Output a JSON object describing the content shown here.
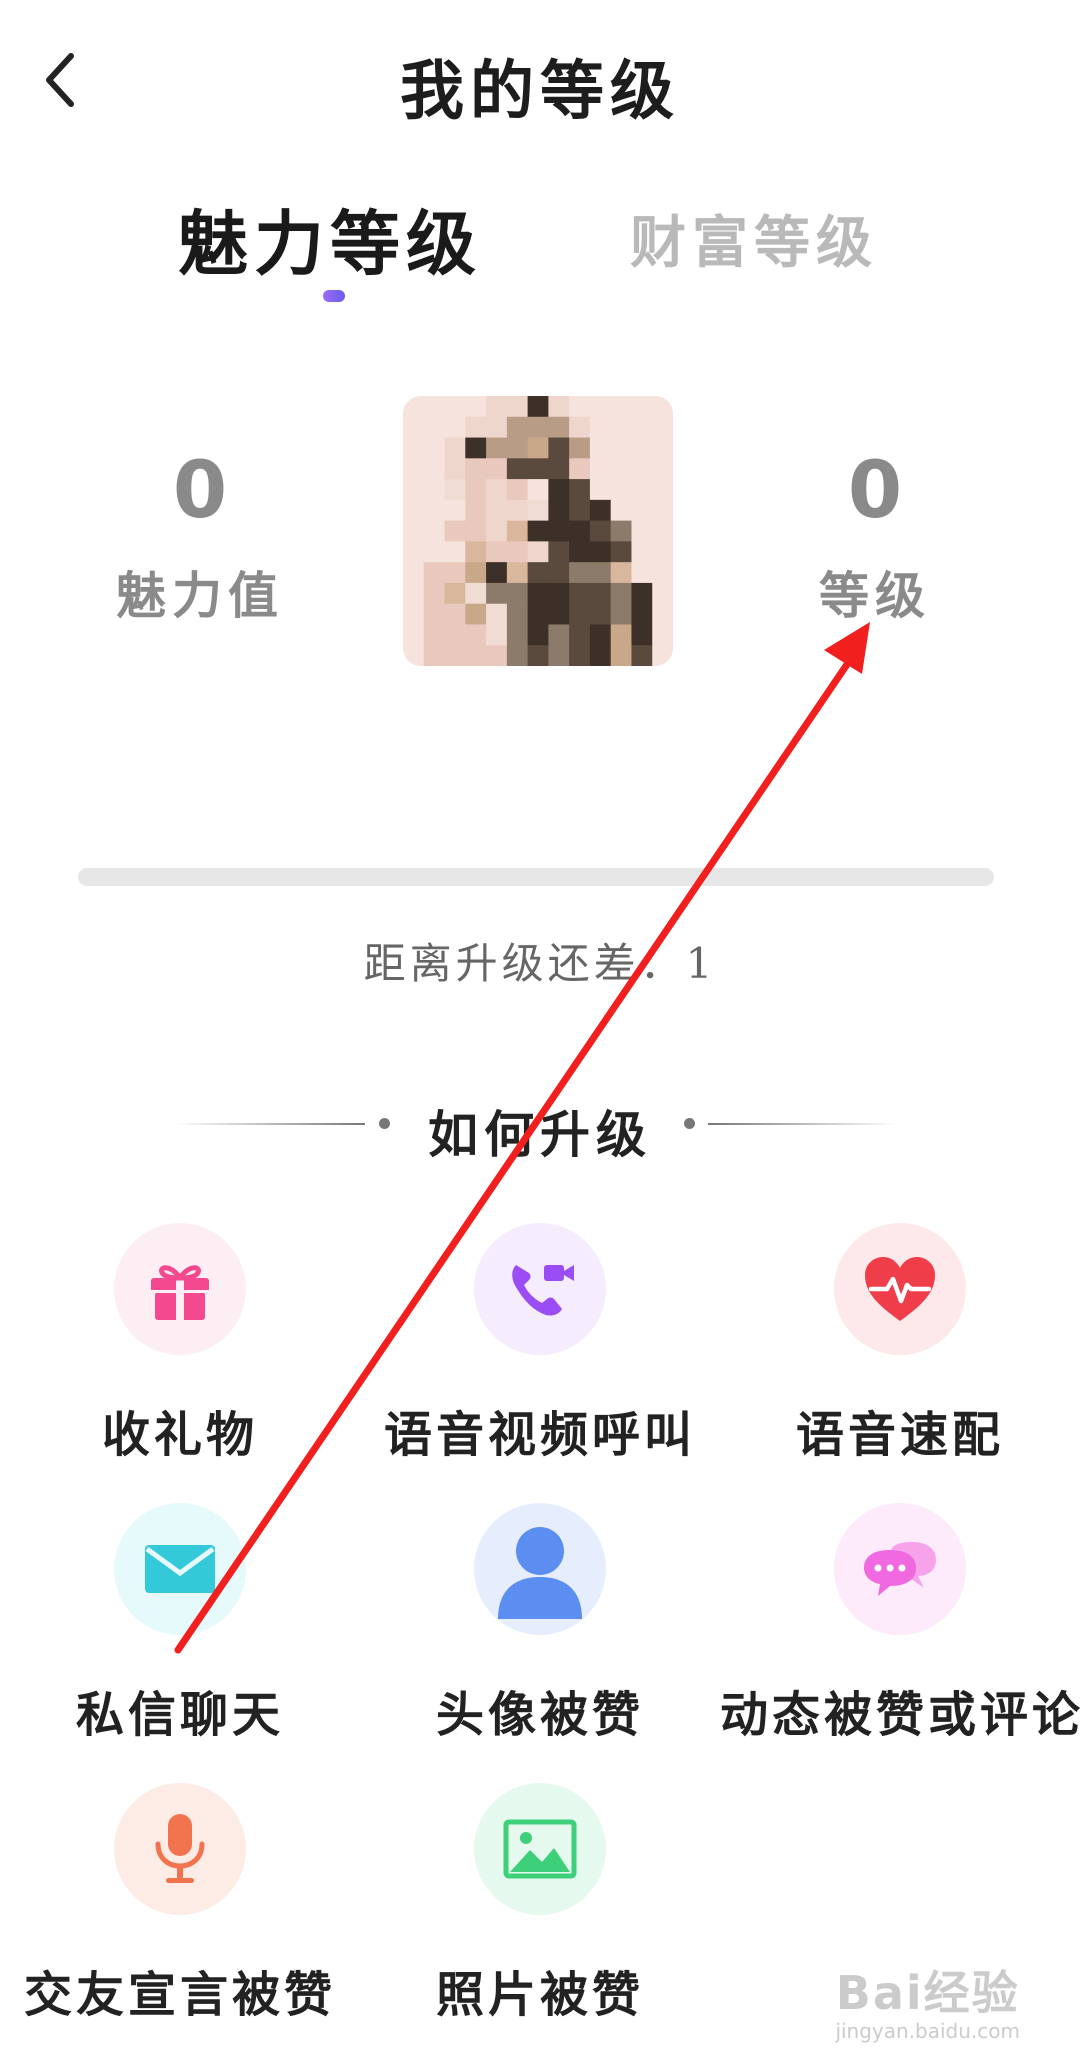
{
  "header": {
    "title": "我的等级",
    "back_icon": "chevron-left-icon"
  },
  "tabs": [
    {
      "label": "魅力等级",
      "active": true
    },
    {
      "label": "财富等级",
      "active": false
    }
  ],
  "stats": {
    "charm_value": "0",
    "charm_label": "魅力值",
    "level_value": "0",
    "level_label": "等级"
  },
  "progress": {
    "fraction": 0,
    "remaining_text": "距离升级还差：1"
  },
  "how_to_upgrade": {
    "title": "如何升级",
    "items": [
      {
        "label": "收礼物",
        "icon": "gift-icon",
        "color": "#f5498f",
        "bg": "#fdeef4"
      },
      {
        "label": "语音视频呼叫",
        "icon": "video-call-icon",
        "color": "#9b4df5",
        "bg": "#f5ecfe"
      },
      {
        "label": "语音速配",
        "icon": "heartbeat-icon",
        "color": "#ef3d4a",
        "bg": "#fde8ea"
      },
      {
        "label": "私信聊天",
        "icon": "mail-icon",
        "color": "#33c9d9",
        "bg": "#e6f9fb"
      },
      {
        "label": "头像被赞",
        "icon": "user-icon",
        "color": "#5b8ef0",
        "bg": "#e6eefd"
      },
      {
        "label": "动态被赞或评论",
        "icon": "chat-bubbles-icon",
        "color": "#f069e0",
        "bg": "#fdeafb"
      },
      {
        "label": "交友宣言被赞",
        "icon": "microphone-icon",
        "color": "#f2744f",
        "bg": "#fdece6"
      },
      {
        "label": "照片被赞",
        "icon": "image-icon",
        "color": "#3dcf7a",
        "bg": "#e6f9ee"
      }
    ]
  },
  "watermark": {
    "main": "Bai经验",
    "sub": "jingyan.baidu.com"
  },
  "annotation": {
    "color": "#f21f1f"
  }
}
